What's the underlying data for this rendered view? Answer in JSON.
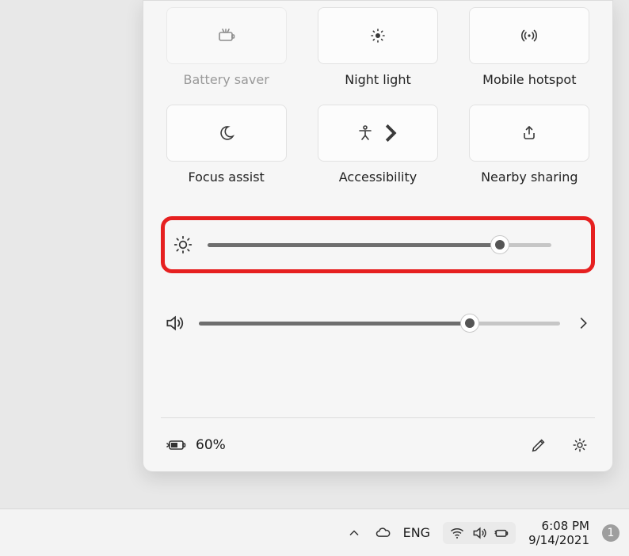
{
  "panel": {
    "tiles": [
      {
        "icon": "battery-saver",
        "label": "Battery saver",
        "disabled": true,
        "has_chevron": false
      },
      {
        "icon": "night-light",
        "label": "Night light",
        "disabled": false,
        "has_chevron": false
      },
      {
        "icon": "hotspot",
        "label": "Mobile hotspot",
        "disabled": false,
        "has_chevron": false
      },
      {
        "icon": "moon",
        "label": "Focus assist",
        "disabled": false,
        "has_chevron": false
      },
      {
        "icon": "accessibility",
        "label": "Accessibility",
        "disabled": false,
        "has_chevron": true
      },
      {
        "icon": "share",
        "label": "Nearby sharing",
        "disabled": false,
        "has_chevron": false
      }
    ],
    "brightness": {
      "percent": 85
    },
    "volume": {
      "percent": 75
    },
    "battery": {
      "percent_label": "60%"
    }
  },
  "taskbar": {
    "language": "ENG",
    "time": "6:08 PM",
    "date": "9/14/2021",
    "notifications": "1"
  },
  "annotation": {
    "highlight_color": "#e62020"
  }
}
